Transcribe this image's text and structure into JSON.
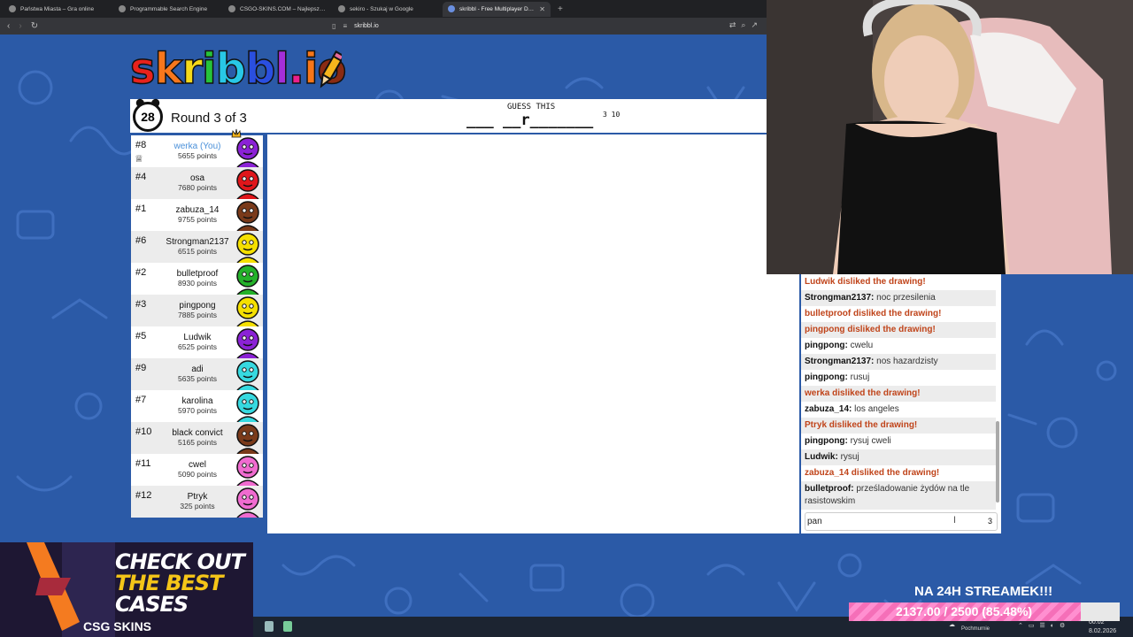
{
  "browser": {
    "tabs": [
      {
        "label": "Państwa Miasta – Gra online",
        "active": false
      },
      {
        "label": "Programmable Search Engine",
        "active": false
      },
      {
        "label": "CSGO-SKINS.COM – Najlepsze Skrzy",
        "active": false
      },
      {
        "label": "sekiro - Szukaj w Google",
        "active": false
      },
      {
        "label": "skribbl - Free Multiplayer Drawi",
        "active": true
      }
    ],
    "url": "skribbl.io"
  },
  "game": {
    "logo_letters": [
      "s",
      "k",
      "r",
      "i",
      "b",
      "b",
      "l",
      ".",
      "i",
      "o"
    ],
    "logo_colors": [
      "#e8221c",
      "#f7771c",
      "#f5d91a",
      "#26c33a",
      "#28c7e6",
      "#2a4fe0",
      "#a42fd8",
      "#ea1f8c",
      "#f77618",
      "#8a2b13"
    ],
    "timer": "28",
    "round": "Round 3 of 3",
    "guess_title": "GUESS THIS",
    "word_hint": "___ __r_______",
    "word_lengths": "3 10"
  },
  "players": [
    {
      "rank": "#8",
      "name": "werka (You)",
      "points": "5655 points",
      "color": "#8b22d6",
      "me": true,
      "crown": true
    },
    {
      "rank": "#4",
      "name": "osa",
      "points": "7680 points",
      "color": "#e0161b",
      "me": false
    },
    {
      "rank": "#1",
      "name": "zabuza_14",
      "points": "9755 points",
      "color": "#7a3a1a",
      "me": false
    },
    {
      "rank": "#6",
      "name": "Strongman2137",
      "points": "6515 points",
      "color": "#f5e000",
      "me": false
    },
    {
      "rank": "#2",
      "name": "bulletproof",
      "points": "8930 points",
      "color": "#24b22a",
      "me": false
    },
    {
      "rank": "#3",
      "name": "pingpong",
      "points": "7885 points",
      "color": "#f5e000",
      "me": false
    },
    {
      "rank": "#5",
      "name": "Ludwik",
      "points": "6525 points",
      "color": "#8b22d6",
      "me": false
    },
    {
      "rank": "#9",
      "name": "adi",
      "points": "5635 points",
      "color": "#36d9e0",
      "me": false
    },
    {
      "rank": "#7",
      "name": "karolina",
      "points": "5970 points",
      "color": "#36d9e0",
      "me": false
    },
    {
      "rank": "#10",
      "name": "black convict",
      "points": "5165 points",
      "color": "#7a3a1a",
      "me": false
    },
    {
      "rank": "#11",
      "name": "cwel",
      "points": "5090 points",
      "color": "#f06bd0",
      "me": false
    },
    {
      "rank": "#12",
      "name": "Ptryk",
      "points": "325 points",
      "color": "#f06bd0",
      "me": false
    }
  ],
  "chat": {
    "messages": [
      {
        "type": "sys",
        "text": "Ludwik disliked the drawing!"
      },
      {
        "type": "msg",
        "user": "Strongman2137:",
        "text": "noc przesilenia"
      },
      {
        "type": "sys",
        "text": "bulletproof disliked the drawing!"
      },
      {
        "type": "sys",
        "text": "pingpong disliked the drawing!"
      },
      {
        "type": "msg",
        "user": "pingpong:",
        "text": "cwelu"
      },
      {
        "type": "msg",
        "user": "Strongman2137:",
        "text": "nos hazardzisty"
      },
      {
        "type": "msg",
        "user": "pingpong:",
        "text": "rusuj"
      },
      {
        "type": "sys",
        "text": "werka disliked the drawing!"
      },
      {
        "type": "msg",
        "user": "zabuza_14:",
        "text": "los angeles"
      },
      {
        "type": "sys",
        "text": "Ptryk disliked the drawing!"
      },
      {
        "type": "msg",
        "user": "pingpong:",
        "text": "rysuj cweli"
      },
      {
        "type": "msg",
        "user": "Ludwik:",
        "text": "rysuj"
      },
      {
        "type": "sys",
        "text": "zabuza_14 disliked the drawing!"
      },
      {
        "type": "msg",
        "user": "bulletproof:",
        "text": "prześladowanie żydów na tle rasistowskim"
      }
    ],
    "input_value": "pan",
    "char_count": "3"
  },
  "ad": {
    "lines": [
      "CHECK OUT",
      "THE BEST",
      "CASES"
    ],
    "line_colors": [
      "#ffffff",
      "#f5c518",
      "#ffffff"
    ],
    "brand": "CSG SKINS"
  },
  "goal": {
    "title": "NA 24H STREAMEK!!!",
    "text": "2137.00 / 2500 (85.48%)",
    "progress": 0.8548
  },
  "taskbar": {
    "weather": "Pochmurnie",
    "time": "00:02",
    "date": "8.02.2026"
  }
}
